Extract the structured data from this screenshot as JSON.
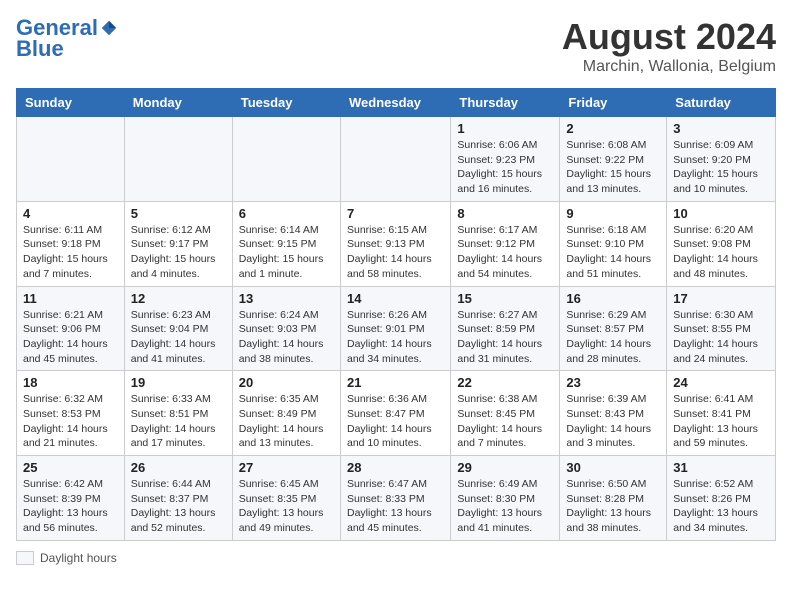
{
  "header": {
    "logo_line1": "General",
    "logo_line2": "Blue",
    "month": "August 2024",
    "location": "Marchin, Wallonia, Belgium"
  },
  "weekdays": [
    "Sunday",
    "Monday",
    "Tuesday",
    "Wednesday",
    "Thursday",
    "Friday",
    "Saturday"
  ],
  "weeks": [
    [
      {
        "day": "",
        "info": ""
      },
      {
        "day": "",
        "info": ""
      },
      {
        "day": "",
        "info": ""
      },
      {
        "day": "",
        "info": ""
      },
      {
        "day": "1",
        "info": "Sunrise: 6:06 AM\nSunset: 9:23 PM\nDaylight: 15 hours and 16 minutes."
      },
      {
        "day": "2",
        "info": "Sunrise: 6:08 AM\nSunset: 9:22 PM\nDaylight: 15 hours and 13 minutes."
      },
      {
        "day": "3",
        "info": "Sunrise: 6:09 AM\nSunset: 9:20 PM\nDaylight: 15 hours and 10 minutes."
      }
    ],
    [
      {
        "day": "4",
        "info": "Sunrise: 6:11 AM\nSunset: 9:18 PM\nDaylight: 15 hours and 7 minutes."
      },
      {
        "day": "5",
        "info": "Sunrise: 6:12 AM\nSunset: 9:17 PM\nDaylight: 15 hours and 4 minutes."
      },
      {
        "day": "6",
        "info": "Sunrise: 6:14 AM\nSunset: 9:15 PM\nDaylight: 15 hours and 1 minute."
      },
      {
        "day": "7",
        "info": "Sunrise: 6:15 AM\nSunset: 9:13 PM\nDaylight: 14 hours and 58 minutes."
      },
      {
        "day": "8",
        "info": "Sunrise: 6:17 AM\nSunset: 9:12 PM\nDaylight: 14 hours and 54 minutes."
      },
      {
        "day": "9",
        "info": "Sunrise: 6:18 AM\nSunset: 9:10 PM\nDaylight: 14 hours and 51 minutes."
      },
      {
        "day": "10",
        "info": "Sunrise: 6:20 AM\nSunset: 9:08 PM\nDaylight: 14 hours and 48 minutes."
      }
    ],
    [
      {
        "day": "11",
        "info": "Sunrise: 6:21 AM\nSunset: 9:06 PM\nDaylight: 14 hours and 45 minutes."
      },
      {
        "day": "12",
        "info": "Sunrise: 6:23 AM\nSunset: 9:04 PM\nDaylight: 14 hours and 41 minutes."
      },
      {
        "day": "13",
        "info": "Sunrise: 6:24 AM\nSunset: 9:03 PM\nDaylight: 14 hours and 38 minutes."
      },
      {
        "day": "14",
        "info": "Sunrise: 6:26 AM\nSunset: 9:01 PM\nDaylight: 14 hours and 34 minutes."
      },
      {
        "day": "15",
        "info": "Sunrise: 6:27 AM\nSunset: 8:59 PM\nDaylight: 14 hours and 31 minutes."
      },
      {
        "day": "16",
        "info": "Sunrise: 6:29 AM\nSunset: 8:57 PM\nDaylight: 14 hours and 28 minutes."
      },
      {
        "day": "17",
        "info": "Sunrise: 6:30 AM\nSunset: 8:55 PM\nDaylight: 14 hours and 24 minutes."
      }
    ],
    [
      {
        "day": "18",
        "info": "Sunrise: 6:32 AM\nSunset: 8:53 PM\nDaylight: 14 hours and 21 minutes."
      },
      {
        "day": "19",
        "info": "Sunrise: 6:33 AM\nSunset: 8:51 PM\nDaylight: 14 hours and 17 minutes."
      },
      {
        "day": "20",
        "info": "Sunrise: 6:35 AM\nSunset: 8:49 PM\nDaylight: 14 hours and 13 minutes."
      },
      {
        "day": "21",
        "info": "Sunrise: 6:36 AM\nSunset: 8:47 PM\nDaylight: 14 hours and 10 minutes."
      },
      {
        "day": "22",
        "info": "Sunrise: 6:38 AM\nSunset: 8:45 PM\nDaylight: 14 hours and 7 minutes."
      },
      {
        "day": "23",
        "info": "Sunrise: 6:39 AM\nSunset: 8:43 PM\nDaylight: 14 hours and 3 minutes."
      },
      {
        "day": "24",
        "info": "Sunrise: 6:41 AM\nSunset: 8:41 PM\nDaylight: 13 hours and 59 minutes."
      }
    ],
    [
      {
        "day": "25",
        "info": "Sunrise: 6:42 AM\nSunset: 8:39 PM\nDaylight: 13 hours and 56 minutes."
      },
      {
        "day": "26",
        "info": "Sunrise: 6:44 AM\nSunset: 8:37 PM\nDaylight: 13 hours and 52 minutes."
      },
      {
        "day": "27",
        "info": "Sunrise: 6:45 AM\nSunset: 8:35 PM\nDaylight: 13 hours and 49 minutes."
      },
      {
        "day": "28",
        "info": "Sunrise: 6:47 AM\nSunset: 8:33 PM\nDaylight: 13 hours and 45 minutes."
      },
      {
        "day": "29",
        "info": "Sunrise: 6:49 AM\nSunset: 8:30 PM\nDaylight: 13 hours and 41 minutes."
      },
      {
        "day": "30",
        "info": "Sunrise: 6:50 AM\nSunset: 8:28 PM\nDaylight: 13 hours and 38 minutes."
      },
      {
        "day": "31",
        "info": "Sunrise: 6:52 AM\nSunset: 8:26 PM\nDaylight: 13 hours and 34 minutes."
      }
    ]
  ],
  "footer": {
    "legend_label": "Daylight hours"
  }
}
